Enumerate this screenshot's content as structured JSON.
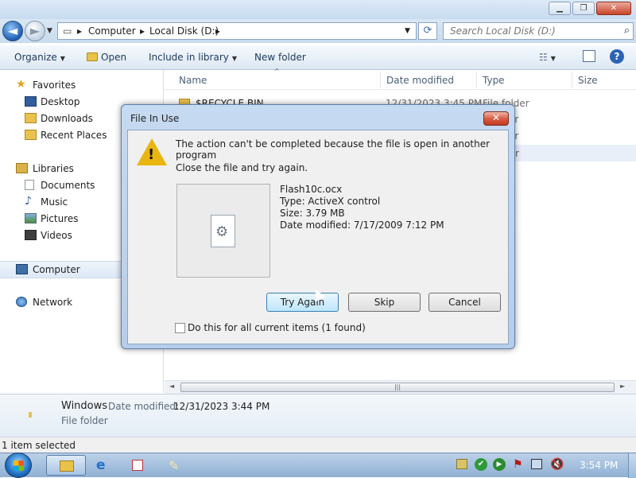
{
  "explorer": {
    "address": {
      "crumbs": [
        "Computer",
        "Local Disk (D:)"
      ]
    },
    "search": {
      "placeholder": "Search Local Disk (D:)"
    },
    "toolbar": {
      "organize": "Organize",
      "open": "Open",
      "include": "Include in library",
      "new_folder": "New folder"
    },
    "nav": {
      "favorites": "Favorites",
      "desktop": "Desktop",
      "downloads": "Downloads",
      "recent": "Recent Places",
      "libraries": "Libraries",
      "documents": "Documents",
      "music": "Music",
      "pictures": "Pictures",
      "videos": "Videos",
      "computer": "Computer",
      "network": "Network"
    },
    "columns": {
      "name": "Name",
      "date": "Date modified",
      "type": "Type",
      "size": "Size"
    },
    "rows": [
      {
        "name": "$RECYCLE.BIN",
        "date": "12/31/2023 3:45 PM",
        "type": "File folder"
      },
      {
        "type_tail": "er"
      },
      {
        "type_tail": "er"
      },
      {
        "type_tail": "der"
      }
    ],
    "details": {
      "name": "Windows",
      "date_label": "Date modified:",
      "date": "12/31/2023 3:44 PM",
      "type": "File folder"
    },
    "status": "1 item selected"
  },
  "dialog": {
    "title": "File In Use",
    "close": "✕",
    "message": "The action can't be completed because the file is open in another program",
    "hint": "Close the file and try again.",
    "file": {
      "name": "Flash10c.ocx",
      "type": "Type: ActiveX control",
      "size": "Size: 3.79 MB",
      "date": "Date modified: 7/17/2009 7:12 PM"
    },
    "buttons": {
      "try_again": "Try Again",
      "skip": "Skip",
      "cancel": "Cancel"
    },
    "checkbox": "Do this for all current items (1 found)"
  },
  "taskbar": {
    "time": "3:54 PM"
  }
}
